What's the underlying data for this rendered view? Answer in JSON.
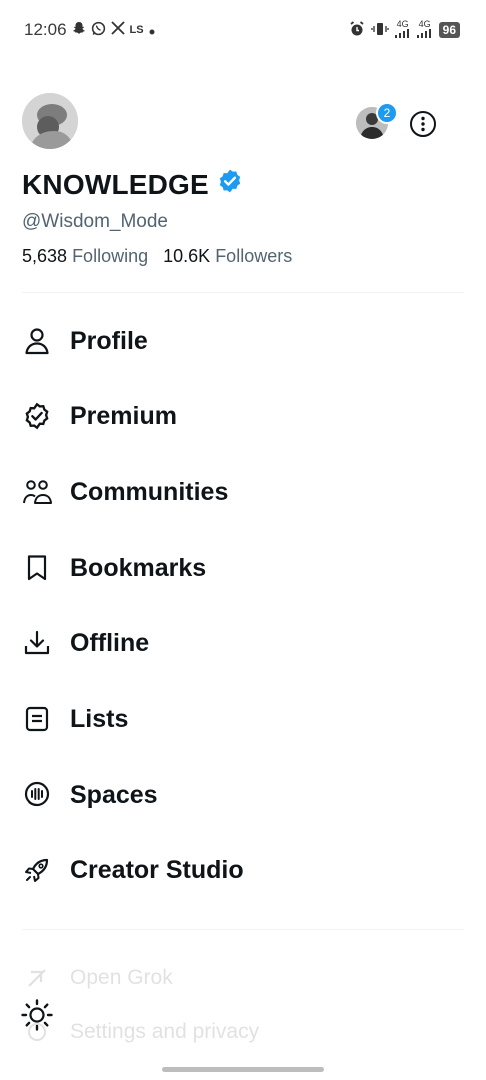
{
  "status_bar": {
    "time": "12:06",
    "left_icons": [
      "snapchat-icon",
      "whatsapp-icon",
      "x-icon",
      "ls-icon",
      "dot-icon"
    ],
    "ls_text": "LS",
    "right_icons": [
      "alarm-icon",
      "vibrate-icon",
      "signal-4g-icon",
      "signal-4g-icon"
    ],
    "net_1": "4G",
    "net_2": "4G",
    "battery": "96"
  },
  "profile": {
    "display_name": "KNOWLEDGE",
    "handle": "@Wisdom_Mode",
    "following_count": "5,638",
    "following_label": "Following",
    "followers_count": "10.6K",
    "followers_label": "Followers",
    "account_badge_count": "2",
    "verified_color": "#1d9bf0"
  },
  "menu": {
    "profile": "Profile",
    "premium": "Premium",
    "communities": "Communities",
    "bookmarks": "Bookmarks",
    "offline": "Offline",
    "lists": "Lists",
    "spaces": "Spaces",
    "creator_studio": "Creator Studio"
  },
  "footer_menu": {
    "open_grok": "Open Grok",
    "settings": "Settings and privacy"
  },
  "colors": {
    "accent": "#1d9bf0",
    "text": "#0f1419",
    "secondary_text": "#536471"
  }
}
